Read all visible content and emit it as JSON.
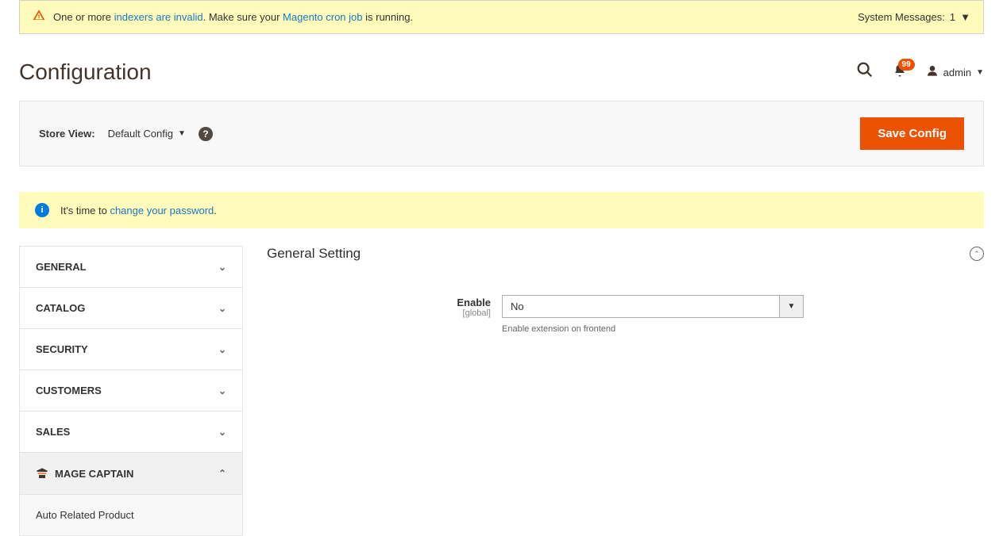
{
  "systemMessage": {
    "prefix": "One or more ",
    "link1": "indexers are invalid",
    "mid1": ". Make sure your ",
    "link2": "Magento cron job",
    "suffix": " is running.",
    "countLabel": "System Messages:",
    "count": "1"
  },
  "pageTitle": "Configuration",
  "notificationCount": "99",
  "adminName": "admin",
  "storeView": {
    "label": "Store View:",
    "value": "Default Config"
  },
  "saveButton": "Save Config",
  "infoMessage": {
    "prefix": "It's time to ",
    "link": "change your password",
    "suffix": "."
  },
  "sidebar": {
    "items": [
      {
        "label": "GENERAL",
        "expanded": false
      },
      {
        "label": "CATALOG",
        "expanded": false
      },
      {
        "label": "SECURITY",
        "expanded": false
      },
      {
        "label": "CUSTOMERS",
        "expanded": false
      },
      {
        "label": "SALES",
        "expanded": false
      },
      {
        "label": "MAGE CAPTAIN",
        "expanded": true
      }
    ],
    "subitem": "Auto Related Product"
  },
  "section": {
    "title": "General Setting",
    "enableLabel": "Enable",
    "enableScope": "[global]",
    "enableValue": "No",
    "enableHint": "Enable extension on frontend"
  }
}
